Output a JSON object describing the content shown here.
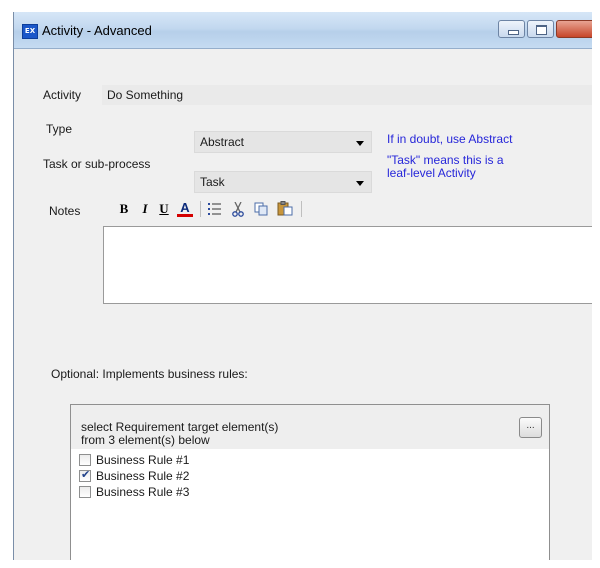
{
  "window": {
    "icon_text": "EX",
    "title": "Activity - Advanced",
    "title_color": "#000000",
    "accent": "#2626d9"
  },
  "form": {
    "activity_label": "Activity",
    "activity_value": "Do Something",
    "type_label": "Type",
    "type_value": "Abstract",
    "type_hint": "If in doubt, use Abstract",
    "task_label": "Task or sub-process",
    "task_value": "Task",
    "task_hint_line1": "\"Task\" means this is a",
    "task_hint_line2": "leaf-level  Activity",
    "notes_label": "Notes"
  },
  "toolbar": {
    "bold": "B",
    "italic": "I",
    "underline": "U",
    "font_color": "A"
  },
  "rules": {
    "section_label": "Optional: Implements business rules:",
    "instruction_line1": "select Requirement target element(s)",
    "instruction_line2": "from 3 element(s) below",
    "browse_label": "...",
    "items": [
      {
        "label": "Business Rule #1",
        "checked": false
      },
      {
        "label": "Business Rule #2",
        "checked": true
      },
      {
        "label": "Business Rule #3",
        "checked": false
      }
    ]
  }
}
